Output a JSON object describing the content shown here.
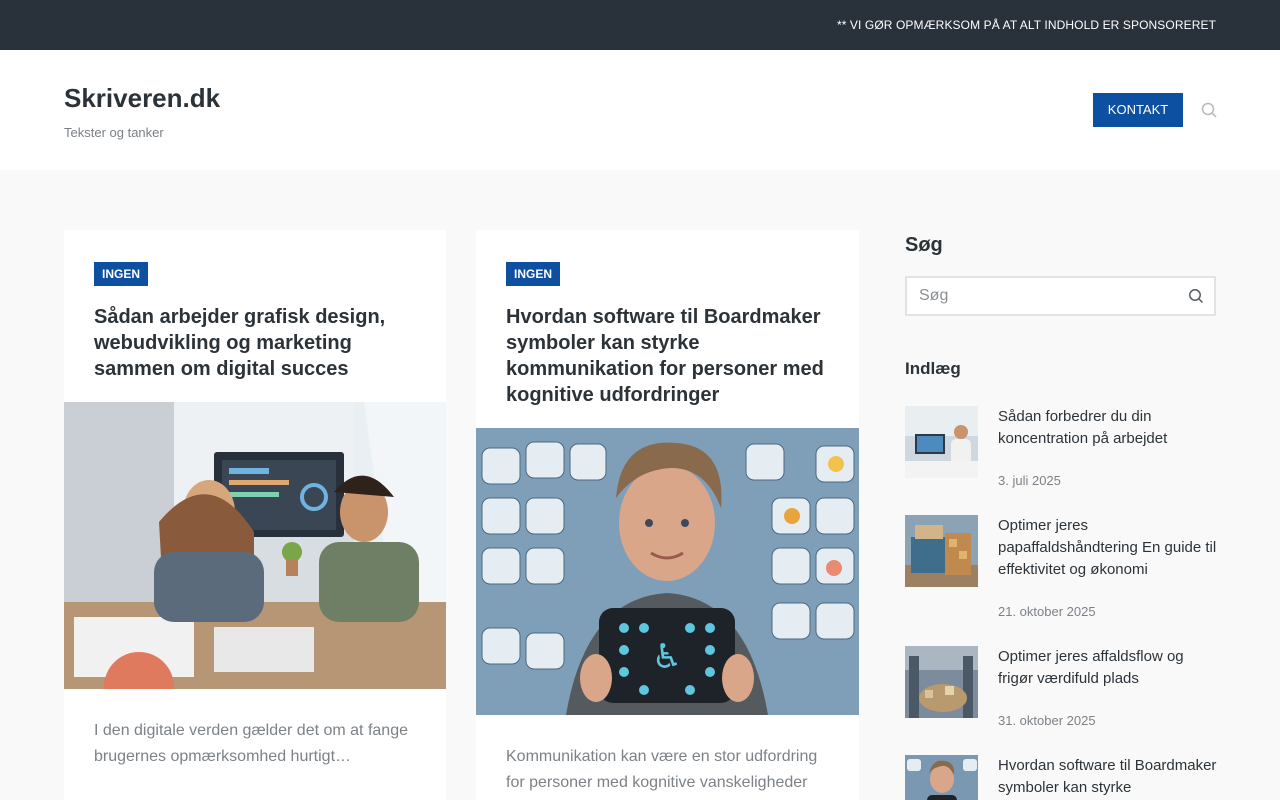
{
  "topbar": {
    "notice": "** VI GØR OPMÆRKSOM PÅ AT ALT INDHOLD ER SPONSORERET"
  },
  "header": {
    "site_title": "Skriveren.dk",
    "tagline": "Tekster og tanker",
    "contact_label": "KONTAKT",
    "search_icon": "search-icon"
  },
  "articles": [
    {
      "category": "INGEN",
      "title": "Sådan arbejder grafisk design, webudvikling og marketing sammen om digital succes",
      "excerpt": "I den digitale verden gælder det om at fange brugernes opmærksomhed hurtigt…"
    },
    {
      "category": "INGEN",
      "title": "Hvordan software til Boardmaker symboler kan styrke kommunikation for personer med kognitive udfordringer",
      "excerpt": "Kommunikation kan være en stor udfordring for personer med kognitive vanskeligheder"
    }
  ],
  "sidebar": {
    "search_heading": "Søg",
    "search_placeholder": "Søg",
    "posts_heading": "Indlæg",
    "posts": [
      {
        "title": "Sådan forbedrer du din koncentration på arbejdet",
        "date": "3. juli 2025"
      },
      {
        "title": "Optimer jeres papaffaldshåndtering En guide til effektivitet og økonomi",
        "date": "21. oktober 2025"
      },
      {
        "title": "Optimer jeres affaldsflow og frigør værdifuld plads",
        "date": "31. oktober 2025"
      },
      {
        "title": "Hvordan software til Boardmaker symboler kan styrke",
        "date": ""
      }
    ]
  },
  "colors": {
    "accent": "#0d4fa0",
    "topbar": "#29313a",
    "text": "#2c3338",
    "muted": "#7d8287"
  }
}
